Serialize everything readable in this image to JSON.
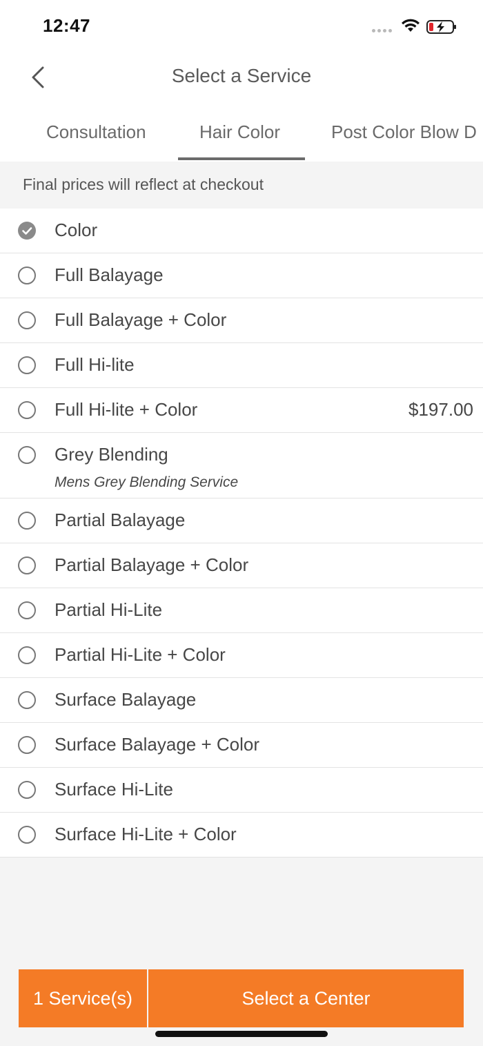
{
  "status": {
    "time": "12:47",
    "icons": [
      "cellular-signal-icon",
      "wifi-icon",
      "battery-charging-icon"
    ]
  },
  "header": {
    "title": "Select a Service",
    "back_icon": "chevron-left-icon"
  },
  "tabs": [
    {
      "label": "Consultation",
      "selected": false
    },
    {
      "label": "Hair Color",
      "selected": true
    },
    {
      "label": "Post Color Blow D",
      "selected": false
    }
  ],
  "notice": "Final prices will reflect at checkout",
  "services": [
    {
      "name": "Color",
      "checked": true,
      "price": "",
      "subtitle": ""
    },
    {
      "name": "Full Balayage",
      "checked": false,
      "price": "",
      "subtitle": ""
    },
    {
      "name": "Full Balayage + Color",
      "checked": false,
      "price": "",
      "subtitle": ""
    },
    {
      "name": "Full Hi-lite",
      "checked": false,
      "price": "",
      "subtitle": ""
    },
    {
      "name": "Full Hi-lite + Color",
      "checked": false,
      "price": "$197.00",
      "subtitle": ""
    },
    {
      "name": "Grey Blending",
      "checked": false,
      "price": "",
      "subtitle": "Mens Grey Blending Service"
    },
    {
      "name": "Partial Balayage",
      "checked": false,
      "price": "",
      "subtitle": ""
    },
    {
      "name": "Partial Balayage + Color",
      "checked": false,
      "price": "",
      "subtitle": ""
    },
    {
      "name": "Partial Hi-Lite",
      "checked": false,
      "price": "",
      "subtitle": ""
    },
    {
      "name": "Partial Hi-Lite + Color",
      "checked": false,
      "price": "",
      "subtitle": ""
    },
    {
      "name": "Surface Balayage",
      "checked": false,
      "price": "",
      "subtitle": ""
    },
    {
      "name": "Surface Balayage + Color",
      "checked": false,
      "price": "",
      "subtitle": ""
    },
    {
      "name": "Surface Hi-Lite",
      "checked": false,
      "price": "",
      "subtitle": ""
    },
    {
      "name": "Surface Hi-Lite + Color",
      "checked": false,
      "price": "",
      "subtitle": ""
    }
  ],
  "footer": {
    "count_label": "1 Service(s)",
    "cta_label": "Select a Center"
  },
  "colors": {
    "accent": "#f47b26",
    "battery_low": "#e0252b"
  }
}
